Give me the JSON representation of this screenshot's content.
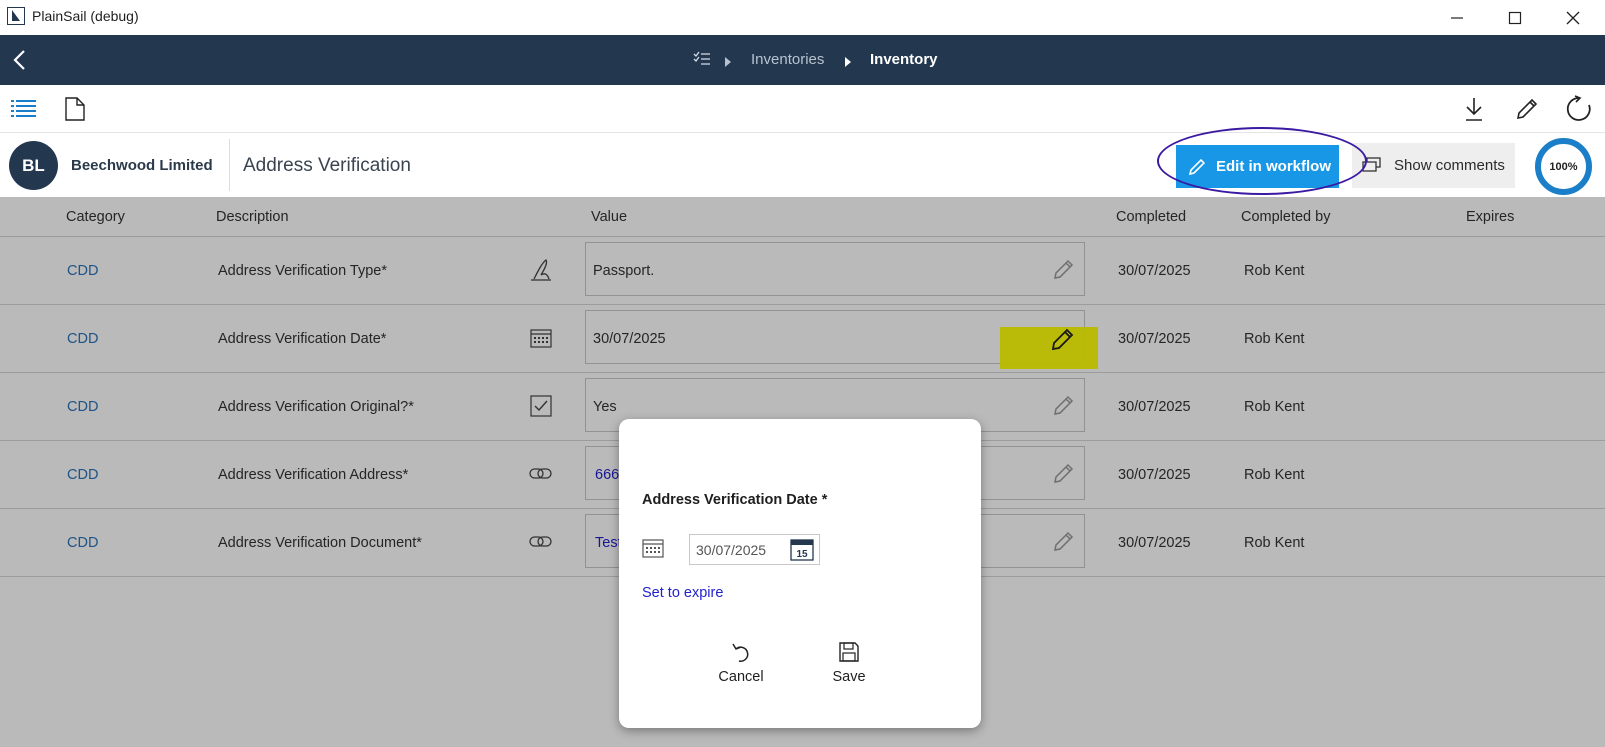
{
  "window": {
    "title": "PlainSail (debug)"
  },
  "nav": {
    "breadcrumbs": [
      "Inventories",
      "Inventory"
    ]
  },
  "header": {
    "avatar_initials": "BL",
    "company": "Beechwood Limited",
    "page_title": "Address Verification",
    "edit_button": "Edit in workflow",
    "comments_button": "Show comments",
    "progress": "100%"
  },
  "table": {
    "columns": [
      "Category",
      "Description",
      "Value",
      "Completed",
      "Completed by",
      "Expires"
    ],
    "rows": [
      {
        "category": "CDD",
        "description": "Address Verification Type*",
        "type_icon": "signature-icon",
        "value": "Passport.",
        "completed": "30/07/2025",
        "completed_by": "Rob Kent",
        "expires": ""
      },
      {
        "category": "CDD",
        "description": "Address Verification Date*",
        "type_icon": "calendar-icon",
        "value": "30/07/2025",
        "completed": "30/07/2025",
        "completed_by": "Rob Kent",
        "expires": ""
      },
      {
        "category": "CDD",
        "description": "Address Verification Original?*",
        "type_icon": "checkbox-icon",
        "value": "Yes",
        "completed": "30/07/2025",
        "completed_by": "Rob Kent",
        "expires": ""
      },
      {
        "category": "CDD",
        "description": "Address Verification Address*",
        "type_icon": "link-icon",
        "value": "666",
        "completed": "30/07/2025",
        "completed_by": "Rob Kent",
        "expires": ""
      },
      {
        "category": "CDD",
        "description": "Address Verification Document*",
        "type_icon": "link-icon",
        "value": "Test",
        "completed": "30/07/2025",
        "completed_by": "Rob Kent",
        "expires": ""
      }
    ]
  },
  "dialog": {
    "title": "Address Verification Date *",
    "date_value": "30/07/2025",
    "calendar_day": "15",
    "set_expire": "Set to expire",
    "cancel": "Cancel",
    "save": "Save"
  },
  "colors": {
    "navbar": "#23374f",
    "accent_button": "#1797e6",
    "highlight": "#ffff00",
    "annotation_oval": "#3b1aa3",
    "link": "#2222cc"
  }
}
